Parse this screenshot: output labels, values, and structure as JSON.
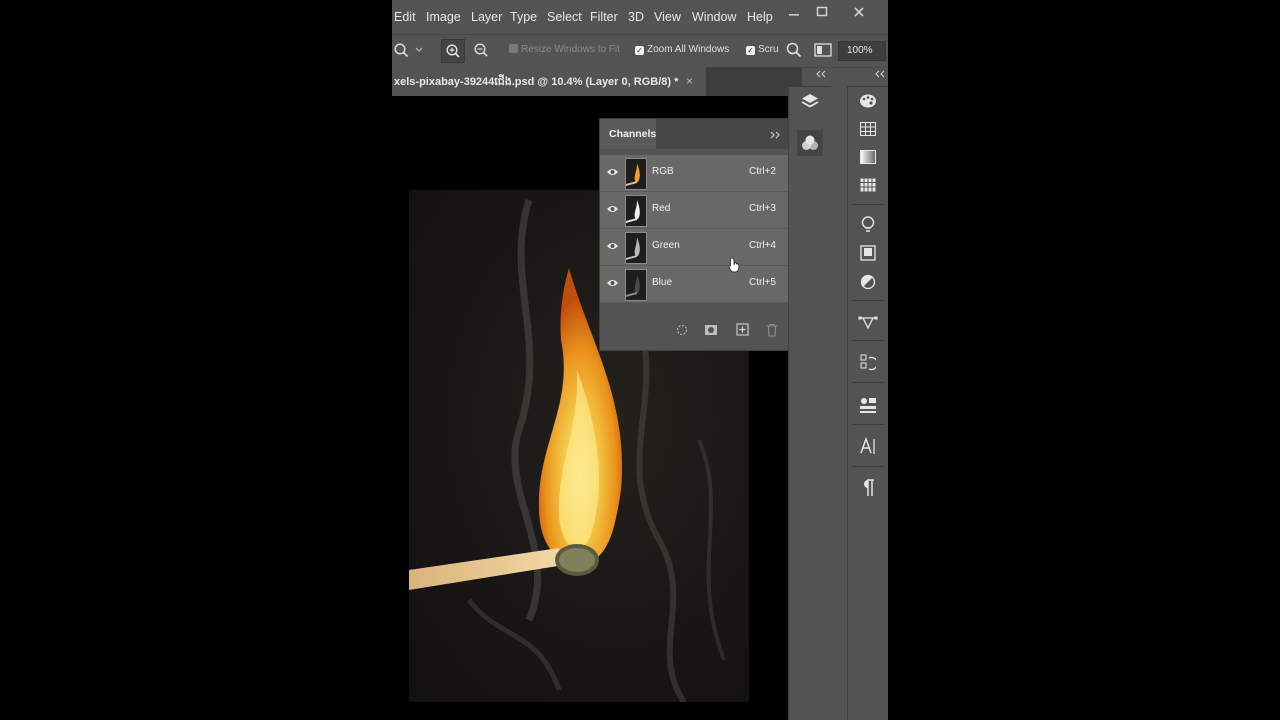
{
  "menu": {
    "items": [
      "Edit",
      "Image",
      "Layer",
      "Type",
      "Select",
      "Filter",
      "3D",
      "View",
      "Window",
      "Help"
    ]
  },
  "options": {
    "resize_label": "Resize Windows to Fit",
    "zoom_all_label": "Zoom All Windows",
    "scrubby_label": "Scru",
    "zoom_value": "100%"
  },
  "document": {
    "tab_title": "xels-pixabay-39244ជើង.psd @ 10.4% (Layer 0, RGB/8) *",
    "close": "×"
  },
  "channels_panel": {
    "title": "Channels",
    "rows": [
      {
        "name": "RGB",
        "shortcut": "Ctrl+2"
      },
      {
        "name": "Red",
        "shortcut": "Ctrl+3"
      },
      {
        "name": "Green",
        "shortcut": "Ctrl+4"
      },
      {
        "name": "Blue",
        "shortcut": "Ctrl+5"
      }
    ]
  },
  "colors": {
    "ui_bg": "#535353",
    "row_bg": "#686868",
    "flame_core": "#ffd24a",
    "flame_outer": "#f07a10"
  }
}
